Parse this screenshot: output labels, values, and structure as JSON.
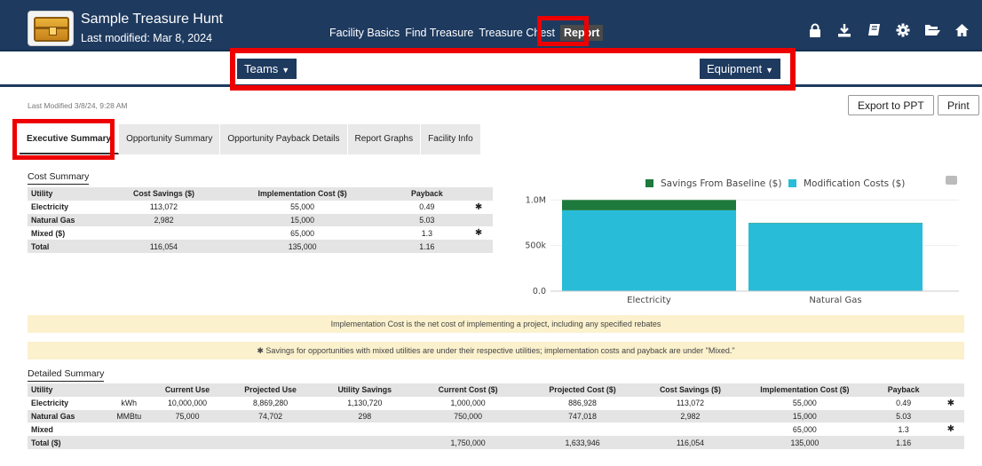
{
  "header": {
    "app_title": "Sample Treasure Hunt",
    "last_modified": "Last modified: Mar 8, 2024",
    "nav": [
      "Facility Basics",
      "Find Treasure",
      "Treasure Chest",
      "Report"
    ],
    "icons": [
      "lock-icon",
      "download-icon",
      "book-icon",
      "gear-icon",
      "folder-open-icon",
      "home-icon"
    ]
  },
  "filters": {
    "teams": "Teams",
    "equipment": "Equipment"
  },
  "toolbar": {
    "modified": "Last Modified 3/8/24, 9:28 AM",
    "export": "Export to PPT",
    "print": "Print"
  },
  "tabs": [
    "Executive Summary",
    "Opportunity Summary",
    "Opportunity Payback Details",
    "Report Graphs",
    "Facility Info"
  ],
  "cost_summary": {
    "title": "Cost Summary",
    "headers": [
      "Utility",
      "Cost Savings ($)",
      "Implementation Cost ($)",
      "Payback",
      ""
    ],
    "rows": [
      [
        "Electricity",
        "113,072",
        "55,000",
        "0.49",
        "✱"
      ],
      [
        "Natural Gas",
        "2,982",
        "15,000",
        "5.03",
        ""
      ],
      [
        "Mixed ($)",
        "",
        "65,000",
        "1.3",
        "✱"
      ],
      [
        "Total",
        "116,054",
        "135,000",
        "1.16",
        ""
      ]
    ]
  },
  "notes": {
    "implementation": "Implementation Cost is the net cost of implementing a project, including any specified rebates",
    "mixed": "✱ Savings for opportunities with mixed utilities are under their respective utilities; implementation costs and payback are under \"Mixed.\""
  },
  "detailed_summary": {
    "title": "Detailed Summary",
    "headers": [
      "Utility",
      "",
      "Current Use",
      "Projected Use",
      "Utility Savings",
      "Current Cost ($)",
      "Projected Cost ($)",
      "Cost Savings ($)",
      "Implementation Cost ($)",
      "Payback",
      ""
    ],
    "rows": [
      [
        "Electricity",
        "kWh",
        "10,000,000",
        "8,869,280",
        "1,130,720",
        "1,000,000",
        "886,928",
        "113,072",
        "55,000",
        "0.49",
        "✱"
      ],
      [
        "Natural Gas",
        "MMBtu",
        "75,000",
        "74,702",
        "298",
        "750,000",
        "747,018",
        "2,982",
        "15,000",
        "5.03",
        ""
      ],
      [
        "Mixed",
        "",
        "",
        "",
        "",
        "",
        "",
        "",
        "65,000",
        "1.3",
        "✱"
      ],
      [
        "Total ($)",
        "",
        "",
        "",
        "",
        "1,750,000",
        "1,633,946",
        "116,054",
        "135,000",
        "1.16",
        ""
      ]
    ]
  },
  "chart_data": {
    "type": "bar",
    "categories": [
      "Electricity",
      "Natural Gas"
    ],
    "series": [
      {
        "name": "Savings From Baseline ($)",
        "values": [
          113072,
          2982
        ],
        "color": "#1e7a3c"
      },
      {
        "name": "Modification Costs ($)",
        "values": [
          886928,
          747018
        ],
        "color": "#29bcd8"
      }
    ],
    "stacked": true,
    "yticks": [
      "0.0",
      "500k",
      "1.0M"
    ],
    "ylim": [
      0,
      1100000
    ],
    "legend": "top-right"
  }
}
